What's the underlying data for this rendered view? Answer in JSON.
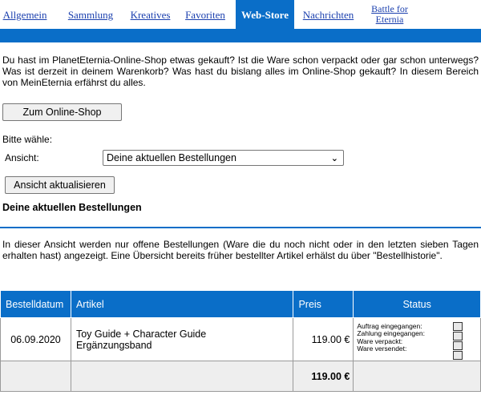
{
  "tabs": [
    {
      "label": "Allgemein",
      "active": false
    },
    {
      "label": "Sammlung",
      "active": false
    },
    {
      "label": "Kreatives",
      "active": false
    },
    {
      "label": "Favoriten",
      "active": false
    },
    {
      "label": "Web-Store",
      "active": true
    },
    {
      "label": "Nachrichten",
      "active": false
    },
    {
      "label_line1": "Battle for",
      "label_line2": "Eternia",
      "active": false
    }
  ],
  "intro": "Du hast im PlanetEternia-Online-Shop etwas gekauft? Ist die Ware schon verpackt oder gar schon unterwegs? Was ist derzeit in deinem Warenkorb? Was hast du bislang alles im Online-Shop gekauft? In diesem Bereich von MeinEternia erfährst du alles.",
  "shop_button": "Zum Online-Shop",
  "choose_label": "Bitte wähle:",
  "view_label": "Ansicht:",
  "view_select": {
    "selected": "Deine aktuellen Bestellungen"
  },
  "refresh_button": "Ansicht aktualisieren",
  "section_title": "Deine aktuellen Bestellungen",
  "note": "In dieser Ansicht werden nur offene Bestellungen (Ware die du noch nicht oder in den letzten sieben Tagen erhalten hast) angezeigt. Eine Übersicht bereits früher bestellter Artikel erhälst du über \"Bestellhistorie\".",
  "table": {
    "headers": [
      "Bestelldatum",
      "Artikel",
      "Preis",
      "Status"
    ],
    "rows": [
      {
        "date": "06.09.2020",
        "article_line1": "Toy Guide + Character Guide",
        "article_line2": "Ergänzungsband",
        "price": "119.00 €",
        "status": [
          "Auftrag eingegangen:",
          "Zahlung eingegangen:",
          "Ware verpackt:",
          "Ware versendet:"
        ]
      }
    ],
    "total": "119.00 €"
  },
  "colors": {
    "accent": "#0a6ec8",
    "link": "#1a3fae"
  }
}
